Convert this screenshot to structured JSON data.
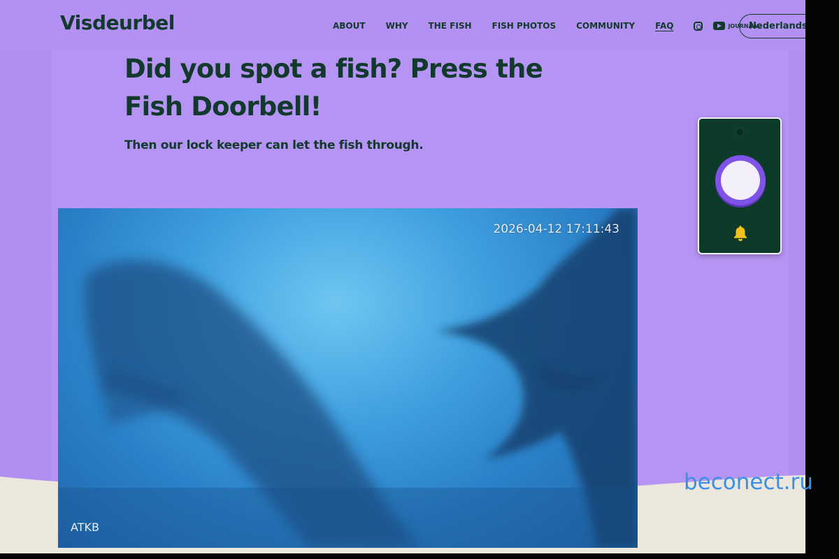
{
  "header": {
    "logo": "Visdeurbel",
    "nav": [
      "ABOUT",
      "WHY",
      "THE FISH",
      "FISH PHOTOS",
      "COMMUNITY",
      "FAQ"
    ],
    "youtube_label": "JOURNAAL",
    "language_button": "Nederlands"
  },
  "hero": {
    "title": "Did you spot a fish? Press the Fish Doorbell!",
    "subtitle": "Then our lock keeper can let the fish through."
  },
  "video": {
    "timestamp": "2026-04-12 17:11:43",
    "camera_label": "ATKB"
  },
  "watermark": "beconect.ru",
  "colors": {
    "background": "#b08ef0",
    "text_dark_green": "#113a2c",
    "doorbell_body": "#0e3a2a",
    "doorbell_button": "#7f52e8",
    "bell_icon": "#f2c21b"
  },
  "icons": [
    "instagram-icon",
    "youtube-icon",
    "bell-icon",
    "camera-icon"
  ]
}
